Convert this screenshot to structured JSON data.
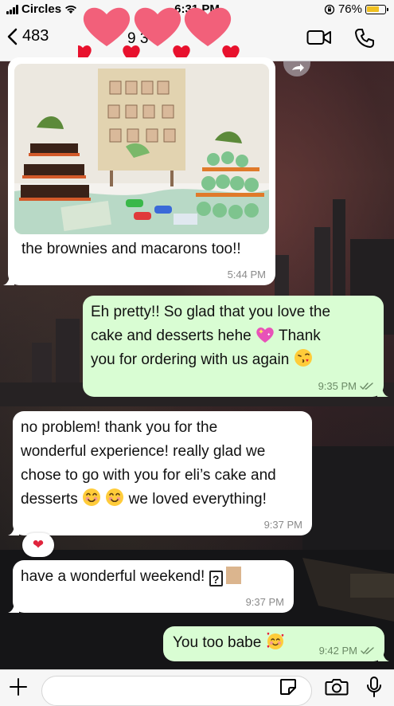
{
  "status_bar": {
    "carrier": "Circles",
    "time": "6:31 PM",
    "battery": "76%",
    "battery_level": 0.76
  },
  "header": {
    "back_count": "483",
    "contact_partial": "9 3"
  },
  "messages": [
    {
      "type": "incoming",
      "kind": "photo",
      "caption": "the brownies and macarons too!!",
      "time": "5:44 PM"
    },
    {
      "type": "outgoing",
      "line1": "Eh pretty!! So glad that you love the",
      "line2a": "cake and desserts hehe",
      "line2b": "Thank",
      "line3": "you for ordering with us again",
      "time": "9:35 PM"
    },
    {
      "type": "incoming",
      "line1": "no problem! thank you for the",
      "line2": "wonderful experience! really glad we",
      "line3": "chose to go with you for eli’s cake and",
      "line4a": "desserts",
      "line4b": "we loved everything!",
      "time": "9:37 PM",
      "reaction": "❤"
    },
    {
      "type": "incoming",
      "text": "have a wonderful weekend!",
      "box": "?",
      "time": "9:37 PM"
    },
    {
      "type": "outgoing",
      "text": "You too babe",
      "time": "9:42 PM"
    }
  ],
  "colors": {
    "outgoing_bubble": "#d9fdd3",
    "incoming_bubble": "#ffffff",
    "bar_background": "#f6f6f6"
  }
}
